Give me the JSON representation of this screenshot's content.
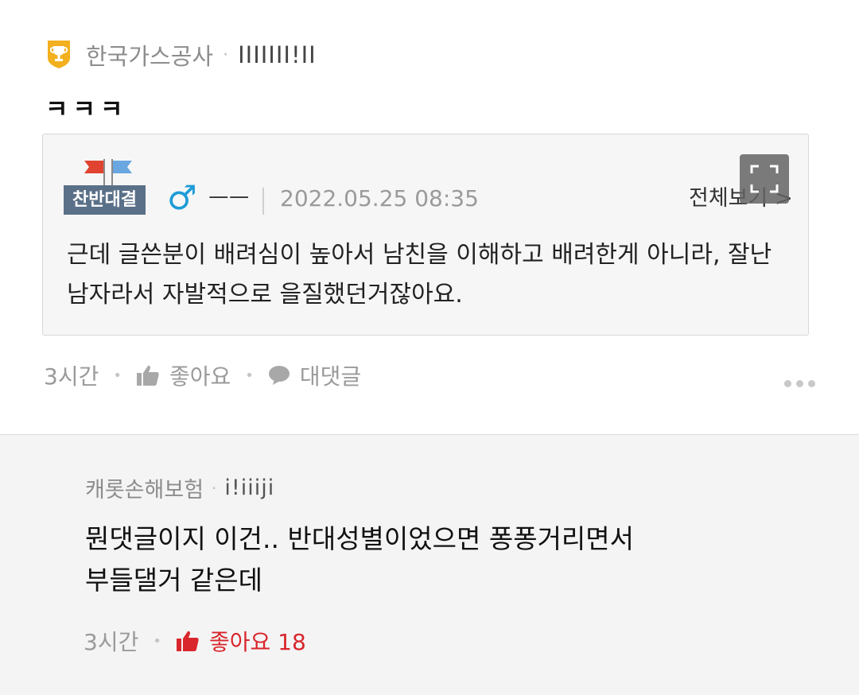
{
  "comment": {
    "author": "한국가스공사",
    "separator": "·",
    "nickname": "IIIIIII!II",
    "body": "ㅋㅋㅋ",
    "time": "3시간",
    "like_label": "좋아요",
    "reply_label": "대댓글",
    "badge_icon": "trophy-badge-icon"
  },
  "quote": {
    "board_tag": "찬반대결",
    "gender_symbol": "♂",
    "nickname": "ㅡㅡ",
    "date": "2022.05.25 08:35",
    "view_all": "전체보기 >",
    "text": "근데 글쓴분이 배려심이 높아서 남친을 이해하고 배려한게 아니라, 잘난 남자라서 자발적으로 을질했던거잖아요."
  },
  "reply": {
    "author": "캐롯손해보험",
    "separator": "·",
    "nickname": "i!iiiji",
    "body_line1": "뭔댓글이지 이건.. 반대성별이었으면 퐁퐁거리면서",
    "body_line2": "부들댈거 같은데",
    "time": "3시간",
    "like_label": "좋아요 18"
  },
  "colors": {
    "board_tag_bg": "#5a7088",
    "gender_blue": "#1e9bd7",
    "liked_red": "#d9262c",
    "badge_gold": "#f2b01e"
  }
}
